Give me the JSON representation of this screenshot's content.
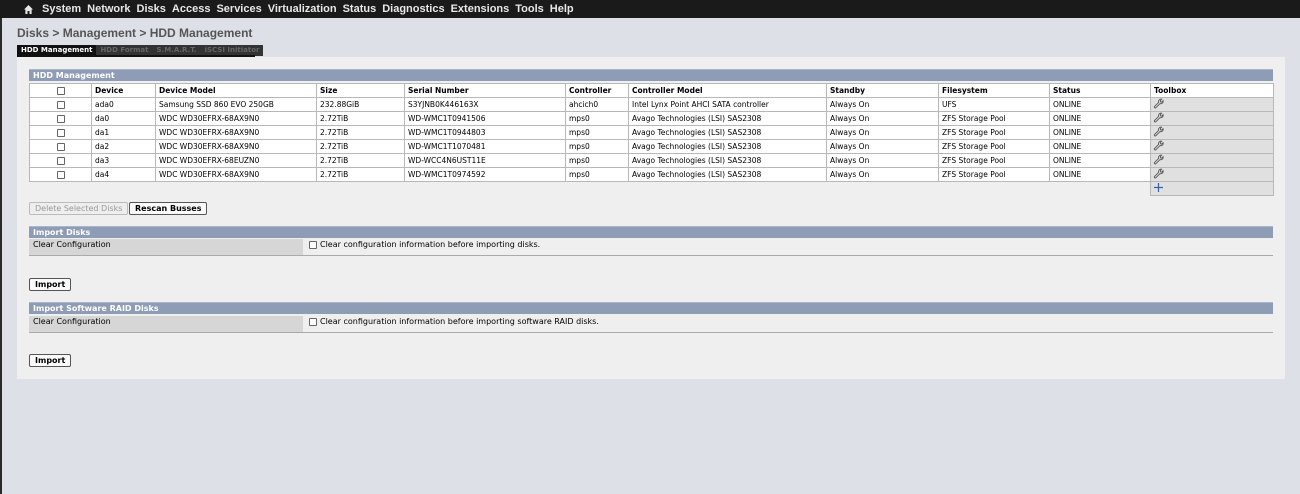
{
  "nav": {
    "items": [
      "System",
      "Network",
      "Disks",
      "Access",
      "Services",
      "Virtualization",
      "Status",
      "Diagnostics",
      "Extensions",
      "Tools",
      "Help"
    ]
  },
  "breadcrumb": "Disks > Management > HDD Management",
  "tabs": [
    {
      "label": "HDD Management",
      "active": true
    },
    {
      "label": "HDD Format",
      "active": false
    },
    {
      "label": "S.M.A.R.T.",
      "active": false
    },
    {
      "label": "iSCSI Initiator",
      "active": false
    }
  ],
  "hdd": {
    "title": "HDD Management",
    "columns": [
      "Device",
      "Device Model",
      "Size",
      "Serial Number",
      "Controller",
      "Controller Model",
      "Standby",
      "Filesystem",
      "Status",
      "Toolbox"
    ],
    "rows": [
      [
        "ada0",
        "Samsung SSD 860 EVO 250GB",
        "232.88GiB",
        "S3YJNB0K446163X",
        "ahcich0",
        "Intel Lynx Point AHCI SATA controller",
        "Always On",
        "UFS",
        "ONLINE"
      ],
      [
        "da0",
        "WDC WD30EFRX-68AX9N0",
        "2.72TiB",
        "WD-WMC1T0941506",
        "mps0",
        "Avago Technologies (LSI) SAS2308",
        "Always On",
        "ZFS Storage Pool",
        "ONLINE"
      ],
      [
        "da1",
        "WDC WD30EFRX-68AX9N0",
        "2.72TiB",
        "WD-WMC1T0944803",
        "mps0",
        "Avago Technologies (LSI) SAS2308",
        "Always On",
        "ZFS Storage Pool",
        "ONLINE"
      ],
      [
        "da2",
        "WDC WD30EFRX-68AX9N0",
        "2.72TiB",
        "WD-WMC1T1070481",
        "mps0",
        "Avago Technologies (LSI) SAS2308",
        "Always On",
        "ZFS Storage Pool",
        "ONLINE"
      ],
      [
        "da3",
        "WDC WD30EFRX-68EUZN0",
        "2.72TiB",
        "WD-WCC4N6UST11E",
        "mps0",
        "Avago Technologies (LSI) SAS2308",
        "Always On",
        "ZFS Storage Pool",
        "ONLINE"
      ],
      [
        "da4",
        "WDC WD30EFRX-68AX9N0",
        "2.72TiB",
        "WD-WMC1T0974592",
        "mps0",
        "Avago Technologies (LSI) SAS2308",
        "Always On",
        "ZFS Storage Pool",
        "ONLINE"
      ]
    ],
    "row_icon": "wrench-icon",
    "add_icon": "plus-icon"
  },
  "buttons": {
    "delete_selected": "Delete Selected Disks",
    "rescan": "Rescan Busses"
  },
  "import_disks": {
    "title": "Import Disks",
    "label": "Clear Configuration",
    "checkbox_text": "Clear configuration information before importing disks.",
    "button": "Import"
  },
  "import_raid": {
    "title": "Import Software RAID Disks",
    "label": "Clear Configuration",
    "checkbox_text": "Clear configuration information before importing software RAID disks.",
    "button": "Import"
  }
}
